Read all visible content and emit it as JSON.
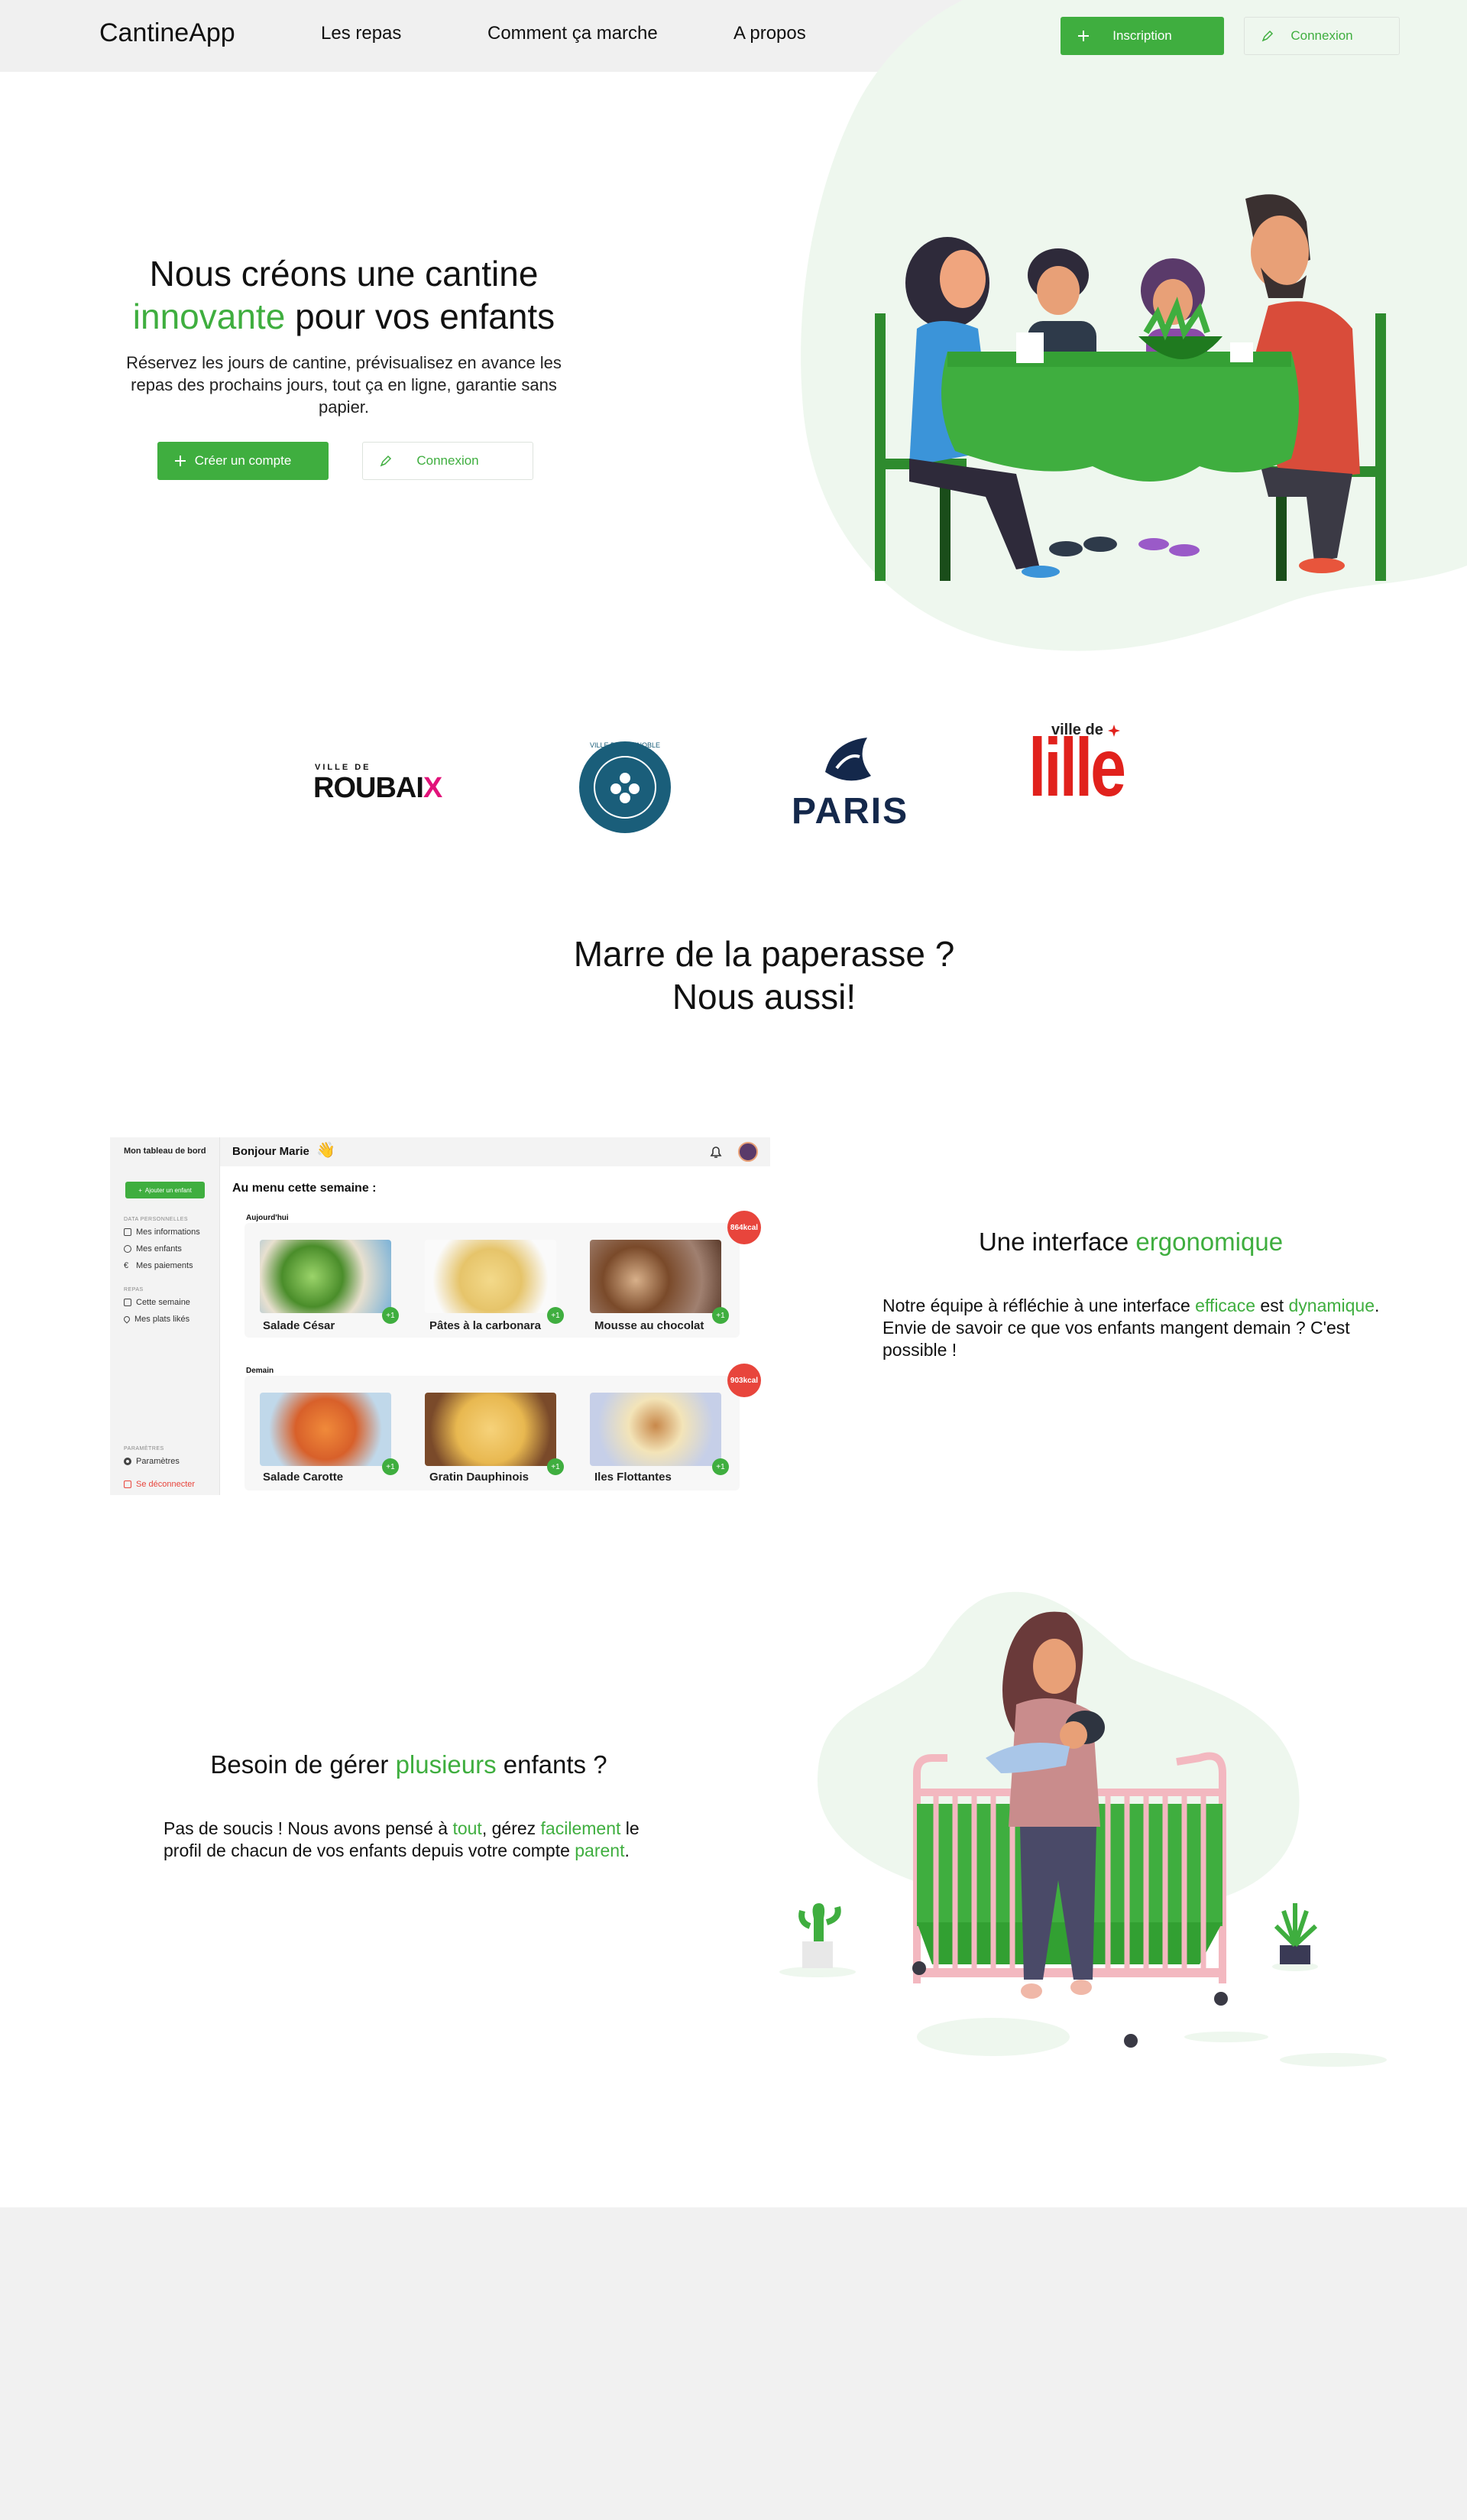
{
  "nav": {
    "logo": "CantineApp",
    "links": [
      "Les repas",
      "Comment ça marche",
      "A propos"
    ],
    "signup_label": "Inscription",
    "login_label": "Connexion"
  },
  "hero": {
    "title_line1": "Nous créons une cantine",
    "title_accent": "innovante",
    "title_rest": " pour vos enfants",
    "description": "Réservez les jours de cantine, prévisualisez en avance les repas des prochains jours, tout ça en ligne, garantie sans papier.",
    "create_account_label": "Créer un compte",
    "login_label": "Connexion"
  },
  "partners": {
    "roubaix_top": "VILLE DE",
    "roubaix_main": "ROUBAI",
    "roubaix_x": "X",
    "grenoble": "VILLE DE GRENOBLE",
    "paris": "PARIS",
    "lille_top": "ville de",
    "lille_main": "lille"
  },
  "paperwork": {
    "line1": "Marre de la paperasse ?",
    "line2": "Nous aussi!"
  },
  "dashboard": {
    "sidebar_title": "Mon tableau de bord",
    "add_child_label": "Ajouter un enfant",
    "section_personal": "DATA PERSONNELLES",
    "personal_items": [
      "Mes informations",
      "Mes enfants",
      "Mes paiements"
    ],
    "section_meals": "REPAS",
    "meal_items": [
      "Cette semaine",
      "Mes plats likés"
    ],
    "section_settings": "PARAMÈTRES",
    "settings_label": "Paramètres",
    "logout_label": "Se déconnecter",
    "greeting": "Bonjour Marie",
    "menu_title": "Au menu cette semaine :",
    "today_label": "Aujourd'hui",
    "today_kcal": "864kcal",
    "today_dishes": [
      "Salade César",
      "Pâtes à la carbonara",
      "Mousse au chocolat"
    ],
    "tomorrow_label": "Demain",
    "tomorrow_kcal": "903kcal",
    "tomorrow_dishes": [
      "Salade Carotte",
      "Gratin Dauphinois",
      "Iles Flottantes"
    ],
    "like_label": "+1"
  },
  "ergonomic": {
    "title_pre": "Une interface ",
    "title_accent": "ergonomique",
    "text_1": "Notre équipe à réfléchie à une interface ",
    "text_accent_1": "efficace",
    "text_2": " est ",
    "text_accent_2": "dynamique",
    "text_3": ". Envie de savoir ce que vos enfants mangent demain ? C'est possible !"
  },
  "multiple": {
    "title_pre": "Besoin de gérer ",
    "title_accent": "plusieurs",
    "title_post": " enfants ?",
    "text_1": "Pas de soucis ! Nous avons pensé à ",
    "text_accent_1": "tout",
    "text_2": ", gérez ",
    "text_accent_2": "facilement",
    "text_3": " le profil de chacun de vos enfants depuis votre compte ",
    "text_accent_3": "parent",
    "text_4": "."
  },
  "colors": {
    "accent": "#3fae3f",
    "nav_bg": "#f0f0f0",
    "blob": "#eef7ee",
    "kcal_badge": "#e8453c",
    "footer_bg": "#f1f1f1"
  }
}
